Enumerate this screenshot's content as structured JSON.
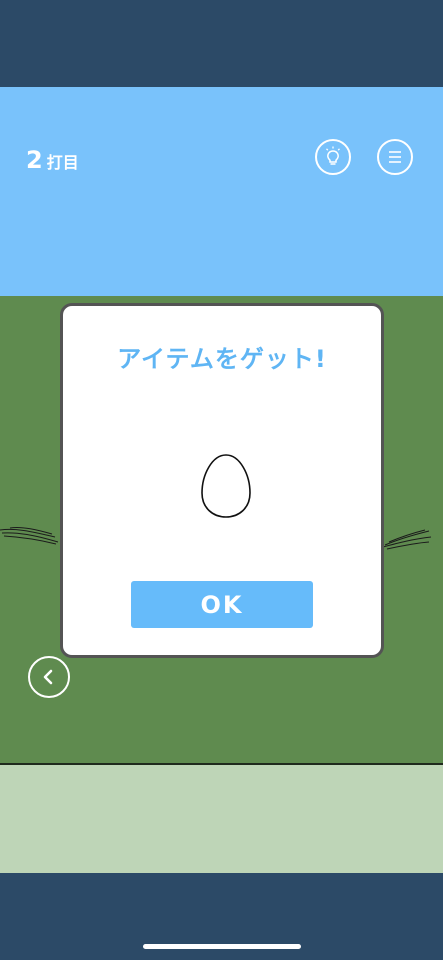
{
  "header": {
    "stroke_count": "2",
    "stroke_unit": "打目",
    "hint_icon": "lightbulb-icon",
    "menu_icon": "menu-icon"
  },
  "navigation": {
    "back_icon": "chevron-left-icon"
  },
  "modal": {
    "title": "アイテムをゲット!",
    "item_icon": "egg-icon",
    "ok_label": "OK"
  },
  "colors": {
    "sky": "#79c2fb",
    "field": "#5f8b4f",
    "tray": "#bed5b7",
    "frame": "#2c4a67",
    "accent": "#66bbfa"
  }
}
